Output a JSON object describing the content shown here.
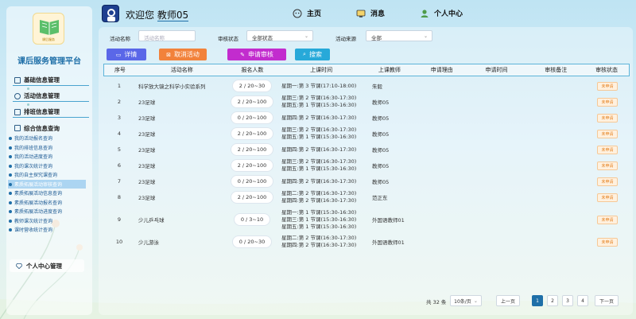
{
  "sidebar": {
    "logo_text": "课后服务",
    "brand": "课后服务管理平台",
    "groups": [
      {
        "label": "基础信息管理"
      },
      {
        "label": "活动信息管理"
      },
      {
        "label": "排班信息管理"
      },
      {
        "label": "综合信息查询"
      }
    ],
    "sub_items": [
      "我的活动报名查询",
      "我的排班信息查询",
      "我的活动进度查询",
      "我的课次统计查询",
      "我的自主探究课查询",
      "素质拓展活动审核查询",
      "素质拓展活动信息查询",
      "素质拓展活动报名查询",
      "素质拓展活动进度查询",
      "教师课次统计查询",
      "课时营收统计查询"
    ],
    "active_sub_index": 5,
    "personal": "个人中心管理"
  },
  "topbar": {
    "welcome_prefix": "欢迎您",
    "username": "教师05",
    "nav": [
      "主页",
      "消息",
      "个人中心"
    ]
  },
  "filters": {
    "name_label": "活动名称",
    "name_placeholder": "活动名称",
    "status_label": "审核状态",
    "status_value": "全部状态",
    "source_label": "活动来源",
    "source_value": "全部"
  },
  "buttons": {
    "detail": "详情",
    "cancel": "取消活动",
    "apply": "申请审核",
    "search": "搜索"
  },
  "table": {
    "headers": [
      "序号",
      "活动名称",
      "报名人数",
      "上课时间",
      "上课教师",
      "申请理由",
      "申请时间",
      "审核备注",
      "审核状态"
    ],
    "rows": [
      {
        "no": "1",
        "name": "科学放大镜之科学小实验系列",
        "count": "2 / 20~30",
        "time": [
          "星期一:第 3 节课(17:10-18:00)"
        ],
        "teacher": "朱毅",
        "status": "未申请"
      },
      {
        "no": "2",
        "name": "23足球",
        "count": "2 / 20~100",
        "time": [
          "星期三:第 2 节课(16:30-17:30)",
          "星期五:第 1 节课(15:30-16:30)"
        ],
        "teacher": "教师05",
        "status": "未申请"
      },
      {
        "no": "3",
        "name": "23足球",
        "count": "0 / 20~100",
        "time": [
          "星期四:第 2 节课(16:30-17:30)"
        ],
        "teacher": "教师05",
        "status": "未申请"
      },
      {
        "no": "4",
        "name": "23足球",
        "count": "2 / 20~100",
        "time": [
          "星期三:第 2 节课(16:30-17:30)",
          "星期五:第 1 节课(15:30-16:30)"
        ],
        "teacher": "教师05",
        "status": "未申请"
      },
      {
        "no": "5",
        "name": "23足球",
        "count": "2 / 20~100",
        "time": [
          "星期四:第 2 节课(16:30-17:30)"
        ],
        "teacher": "教师05",
        "status": "未申请"
      },
      {
        "no": "6",
        "name": "23足球",
        "count": "2 / 20~100",
        "time": [
          "星期三:第 2 节课(16:30-17:30)",
          "星期五:第 1 节课(15:30-16:30)"
        ],
        "teacher": "教师05",
        "status": "未申请"
      },
      {
        "no": "7",
        "name": "23足球",
        "count": "0 / 20~100",
        "time": [
          "星期四:第 2 节课(16:30-17:30)"
        ],
        "teacher": "教师05",
        "status": "未申请"
      },
      {
        "no": "8",
        "name": "23足球",
        "count": "2 / 20~100",
        "time": [
          "星期二:第 2 节课(16:30-17:30)",
          "星期四:第 2 节课(16:30-17:30)"
        ],
        "teacher": "范正东",
        "status": "未申请"
      },
      {
        "no": "9",
        "name": "少儿乒乓球",
        "count": "0 / 3~10",
        "time": [
          "星期一:第 1 节课(15:30-16:30)",
          "星期三:第 1 节课(15:30-16:30)",
          "星期五:第 1 节课(15:30-16:30)"
        ],
        "teacher": "外国语教师01",
        "status": "未申请"
      },
      {
        "no": "10",
        "name": "少儿游泳",
        "count": "0 / 20~30",
        "time": [
          "星期二:第 2 节课(16:30-17:30)",
          "星期四:第 2 节课(16:30-17:30)"
        ],
        "teacher": "外国语教师01",
        "status": "未申请"
      }
    ]
  },
  "pager": {
    "total": "共 32 条",
    "page_size": "10条/页",
    "prev": "上一页",
    "pages": [
      "1",
      "2",
      "3",
      "4"
    ],
    "current": "1",
    "next": "下一页"
  },
  "colors": {
    "accent": "#1f6fa8",
    "detail_btn": "#5a67e8",
    "cancel_btn": "#f2823b",
    "apply_btn": "#c22cce",
    "search_btn": "#27a9d9",
    "badge": "#e47f1c"
  }
}
